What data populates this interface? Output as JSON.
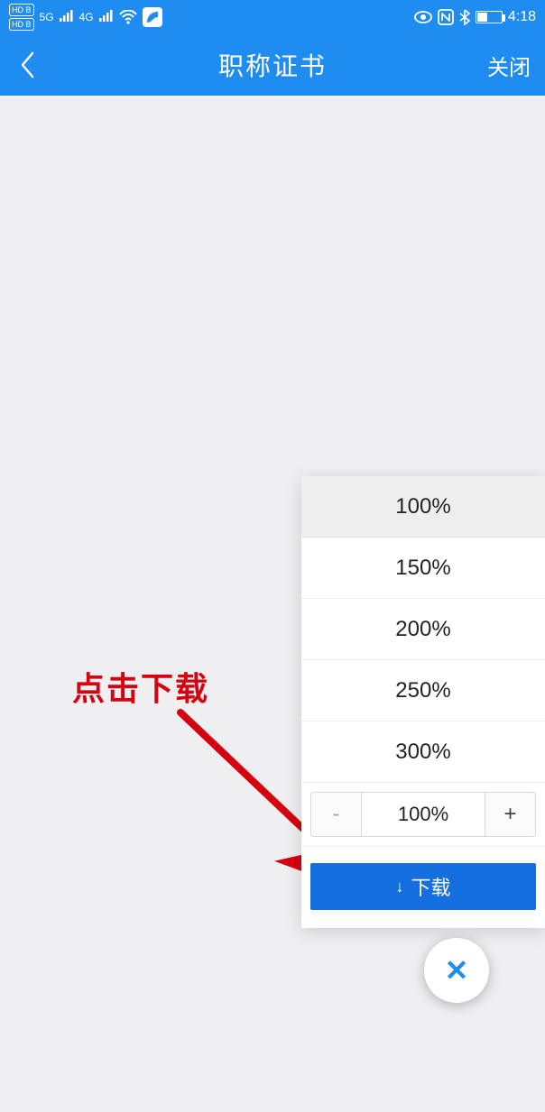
{
  "status_bar": {
    "hd_top": "HD B",
    "hd_bot": "HD B",
    "net5g": "5G",
    "net4g": "4G",
    "time": "4:18"
  },
  "header": {
    "title": "职称证书",
    "close": "关闭"
  },
  "annotation": {
    "text": "点击下载"
  },
  "panel": {
    "zoom_options": [
      "100%",
      "150%",
      "200%",
      "250%",
      "300%"
    ],
    "selected_index": 0,
    "stepper_value": "100%",
    "download_label": "下载"
  }
}
